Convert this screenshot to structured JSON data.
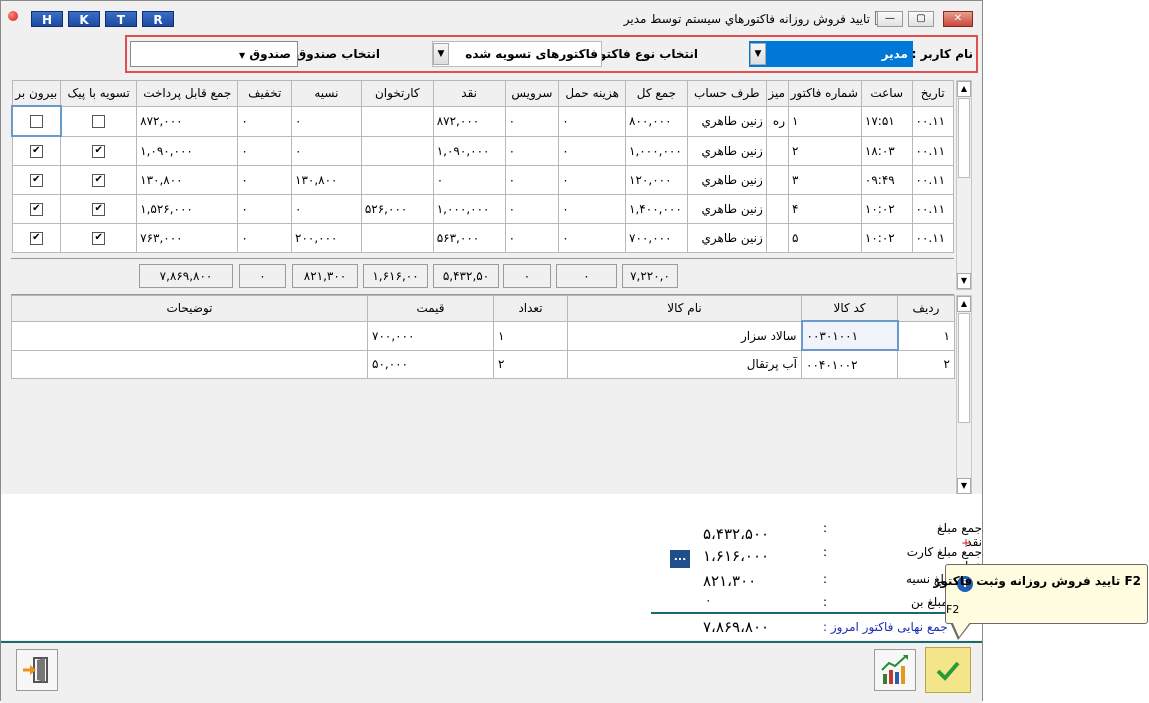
{
  "window": {
    "title": "تاييد فروش روزانه فاكتورهاي سيستم توسط مدير",
    "quick_buttons": [
      "H",
      "K",
      "T",
      "R"
    ],
    "controls": {
      "minimize": "—",
      "maximize": "▢",
      "close": "✕"
    }
  },
  "filters": {
    "user_label": "نام کاربر :",
    "user_value": "مدیر",
    "invoice_type_label": "انتخاب نوع فاکتور :",
    "invoice_type_value": "فاکتورهای تسویه شده",
    "cashbox_label": "انتخاب صندوق :",
    "cashbox_value": "صندوق"
  },
  "invoice_grid": {
    "columns": [
      "تاریخ",
      "ساعت",
      "شماره فاکتور",
      "میز",
      "طرف حساب",
      "جمع کل",
      "هزینه حمل",
      "سرویس",
      "نقد",
      "کارتخوان",
      "نسیه",
      "تخفیف",
      "جمع قابل پرداخت",
      "تسویه با پیک",
      "بیرون بر"
    ],
    "rows": [
      {
        "date": "۰۰.۱۱",
        "time": "۱۷:۵۱",
        "number": "۱",
        "table": "ره ۱",
        "party": "زنین طاهري",
        "total": "۸۰۰,۰۰۰",
        "shipping": "۰",
        "service": "۰",
        "cash": "۸۷۲,۰۰۰",
        "card": "",
        "credit": "۰",
        "discount": "۰",
        "payable": "۸۷۲,۰۰۰",
        "courier": "☐",
        "takeout": "☐"
      },
      {
        "date": "۰۰.۱۱",
        "time": "۱۸:۰۳",
        "number": "۲",
        "table": "",
        "party": "زنین طاهري",
        "total": "۱,۰۰۰,۰۰۰",
        "shipping": "۰",
        "service": "۰",
        "cash": "۱,۰۹۰,۰۰۰",
        "card": "",
        "credit": "۰",
        "discount": "۰",
        "payable": "۱,۰۹۰,۰۰۰",
        "courier": "☑",
        "takeout": "☑"
      },
      {
        "date": "۰۰.۱۱",
        "time": "۰۹:۴۹",
        "number": "۳",
        "table": "",
        "party": "زنین طاهري",
        "total": "۱۲۰,۰۰۰",
        "shipping": "۰",
        "service": "۰",
        "cash": "۰",
        "card": "",
        "credit": "۱۳۰,۸۰۰",
        "discount": "۰",
        "payable": "۱۳۰,۸۰۰",
        "courier": "☑",
        "takeout": "☑"
      },
      {
        "date": "۰۰.۱۱",
        "time": "۱۰:۰۲",
        "number": "۴",
        "table": "",
        "party": "زنین طاهري",
        "total": "۱,۴۰۰,۰۰۰",
        "shipping": "۰",
        "service": "۰",
        "cash": "۱,۰۰۰,۰۰۰",
        "card": "۵۲۶,۰۰۰",
        "credit": "۰",
        "discount": "۰",
        "payable": "۱,۵۲۶,۰۰۰",
        "courier": "☑",
        "takeout": "☑"
      },
      {
        "date": "۰۰.۱۱",
        "time": "۱۰:۰۲",
        "number": "۵",
        "table": "",
        "party": "زنین طاهري",
        "total": "۷۰۰,۰۰۰",
        "shipping": "۰",
        "service": "۰",
        "cash": "۵۶۳,۰۰۰",
        "card": "",
        "credit": "۲۰۰,۰۰۰",
        "discount": "۰",
        "payable": "۷۶۳,۰۰۰",
        "courier": "☑",
        "takeout": "☑"
      }
    ],
    "totals": {
      "total": "۷,۲۲۰,۰",
      "shipping": "۰",
      "service": "۰",
      "cash": "۵,۴۳۲,۵۰",
      "card": "۱,۶۱۶,۰۰",
      "credit": "۸۲۱,۳۰۰",
      "discount": "۰",
      "payable": "۷,۸۶۹,۸۰۰"
    }
  },
  "items_grid": {
    "columns": [
      "ردیف",
      "کد کالا",
      "نام کالا",
      "تعداد",
      "قیمت",
      "توضیحات"
    ],
    "rows": [
      {
        "row": "۱",
        "code": "۰۰۳۰۱۰۰۱",
        "name": "سالاد سزار",
        "qty": "۱",
        "price": "۷۰۰,۰۰۰",
        "notes": ""
      },
      {
        "row": "۲",
        "code": "۰۰۴۰۱۰۰۲",
        "name": "آب پرتقال",
        "qty": "۲",
        "price": "۵۰,۰۰۰",
        "notes": ""
      }
    ]
  },
  "summary": {
    "cash_label": "جمع مبلغ نقد",
    "cash_value": "۵،۴۳۲،۵۰۰",
    "card_label": "جمع مبلغ کارت خوان",
    "card_value": "۱،۶۱۶،۰۰۰",
    "credit_label": "جمع مبلغ نسیه",
    "credit_value": "۸۲۱،۳۰۰",
    "bon_label": "جمع مبلغ بن",
    "bon_value": "۰",
    "final_label": "جمع نهایی فاکتور امروز :",
    "final_value": "۷،۸۶۹،۸۰۰",
    "colon": ":",
    "more_button": "..."
  },
  "tooltip": {
    "title": "F2 تایید فروش روزانه وثبت فاکتور",
    "shortcut": "F2"
  },
  "colors": {
    "accent": "#1a6a6a",
    "highlight": "#0078d7",
    "confirm": "#f5e58a"
  }
}
